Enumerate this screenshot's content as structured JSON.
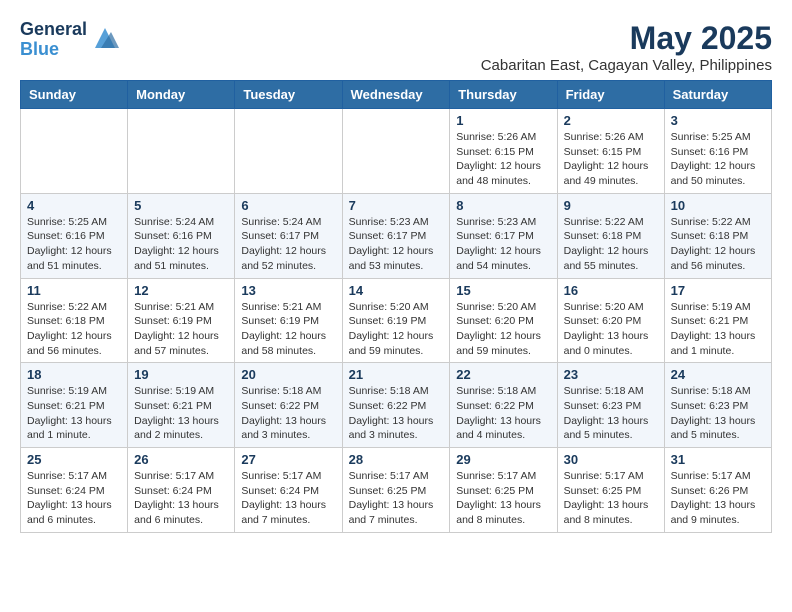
{
  "header": {
    "logo_general": "General",
    "logo_blue": "Blue",
    "month_year": "May 2025",
    "location": "Cabaritan East, Cagayan Valley, Philippines"
  },
  "weekdays": [
    "Sunday",
    "Monday",
    "Tuesday",
    "Wednesday",
    "Thursday",
    "Friday",
    "Saturday"
  ],
  "weeks": [
    [
      {
        "day": "",
        "info": ""
      },
      {
        "day": "",
        "info": ""
      },
      {
        "day": "",
        "info": ""
      },
      {
        "day": "",
        "info": ""
      },
      {
        "day": "1",
        "info": "Sunrise: 5:26 AM\nSunset: 6:15 PM\nDaylight: 12 hours\nand 48 minutes."
      },
      {
        "day": "2",
        "info": "Sunrise: 5:26 AM\nSunset: 6:15 PM\nDaylight: 12 hours\nand 49 minutes."
      },
      {
        "day": "3",
        "info": "Sunrise: 5:25 AM\nSunset: 6:16 PM\nDaylight: 12 hours\nand 50 minutes."
      }
    ],
    [
      {
        "day": "4",
        "info": "Sunrise: 5:25 AM\nSunset: 6:16 PM\nDaylight: 12 hours\nand 51 minutes."
      },
      {
        "day": "5",
        "info": "Sunrise: 5:24 AM\nSunset: 6:16 PM\nDaylight: 12 hours\nand 51 minutes."
      },
      {
        "day": "6",
        "info": "Sunrise: 5:24 AM\nSunset: 6:17 PM\nDaylight: 12 hours\nand 52 minutes."
      },
      {
        "day": "7",
        "info": "Sunrise: 5:23 AM\nSunset: 6:17 PM\nDaylight: 12 hours\nand 53 minutes."
      },
      {
        "day": "8",
        "info": "Sunrise: 5:23 AM\nSunset: 6:17 PM\nDaylight: 12 hours\nand 54 minutes."
      },
      {
        "day": "9",
        "info": "Sunrise: 5:22 AM\nSunset: 6:18 PM\nDaylight: 12 hours\nand 55 minutes."
      },
      {
        "day": "10",
        "info": "Sunrise: 5:22 AM\nSunset: 6:18 PM\nDaylight: 12 hours\nand 56 minutes."
      }
    ],
    [
      {
        "day": "11",
        "info": "Sunrise: 5:22 AM\nSunset: 6:18 PM\nDaylight: 12 hours\nand 56 minutes."
      },
      {
        "day": "12",
        "info": "Sunrise: 5:21 AM\nSunset: 6:19 PM\nDaylight: 12 hours\nand 57 minutes."
      },
      {
        "day": "13",
        "info": "Sunrise: 5:21 AM\nSunset: 6:19 PM\nDaylight: 12 hours\nand 58 minutes."
      },
      {
        "day": "14",
        "info": "Sunrise: 5:20 AM\nSunset: 6:19 PM\nDaylight: 12 hours\nand 59 minutes."
      },
      {
        "day": "15",
        "info": "Sunrise: 5:20 AM\nSunset: 6:20 PM\nDaylight: 12 hours\nand 59 minutes."
      },
      {
        "day": "16",
        "info": "Sunrise: 5:20 AM\nSunset: 6:20 PM\nDaylight: 13 hours\nand 0 minutes."
      },
      {
        "day": "17",
        "info": "Sunrise: 5:19 AM\nSunset: 6:21 PM\nDaylight: 13 hours\nand 1 minute."
      }
    ],
    [
      {
        "day": "18",
        "info": "Sunrise: 5:19 AM\nSunset: 6:21 PM\nDaylight: 13 hours\nand 1 minute."
      },
      {
        "day": "19",
        "info": "Sunrise: 5:19 AM\nSunset: 6:21 PM\nDaylight: 13 hours\nand 2 minutes."
      },
      {
        "day": "20",
        "info": "Sunrise: 5:18 AM\nSunset: 6:22 PM\nDaylight: 13 hours\nand 3 minutes."
      },
      {
        "day": "21",
        "info": "Sunrise: 5:18 AM\nSunset: 6:22 PM\nDaylight: 13 hours\nand 3 minutes."
      },
      {
        "day": "22",
        "info": "Sunrise: 5:18 AM\nSunset: 6:22 PM\nDaylight: 13 hours\nand 4 minutes."
      },
      {
        "day": "23",
        "info": "Sunrise: 5:18 AM\nSunset: 6:23 PM\nDaylight: 13 hours\nand 5 minutes."
      },
      {
        "day": "24",
        "info": "Sunrise: 5:18 AM\nSunset: 6:23 PM\nDaylight: 13 hours\nand 5 minutes."
      }
    ],
    [
      {
        "day": "25",
        "info": "Sunrise: 5:17 AM\nSunset: 6:24 PM\nDaylight: 13 hours\nand 6 minutes."
      },
      {
        "day": "26",
        "info": "Sunrise: 5:17 AM\nSunset: 6:24 PM\nDaylight: 13 hours\nand 6 minutes."
      },
      {
        "day": "27",
        "info": "Sunrise: 5:17 AM\nSunset: 6:24 PM\nDaylight: 13 hours\nand 7 minutes."
      },
      {
        "day": "28",
        "info": "Sunrise: 5:17 AM\nSunset: 6:25 PM\nDaylight: 13 hours\nand 7 minutes."
      },
      {
        "day": "29",
        "info": "Sunrise: 5:17 AM\nSunset: 6:25 PM\nDaylight: 13 hours\nand 8 minutes."
      },
      {
        "day": "30",
        "info": "Sunrise: 5:17 AM\nSunset: 6:25 PM\nDaylight: 13 hours\nand 8 minutes."
      },
      {
        "day": "31",
        "info": "Sunrise: 5:17 AM\nSunset: 6:26 PM\nDaylight: 13 hours\nand 9 minutes."
      }
    ]
  ]
}
